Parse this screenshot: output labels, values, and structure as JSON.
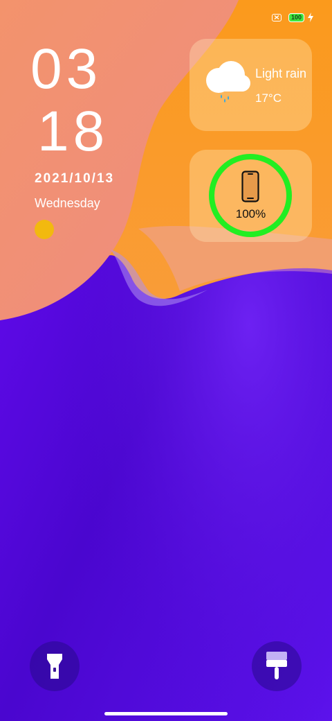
{
  "status_bar": {
    "battery_level": "100",
    "icons": [
      "x-badge-icon",
      "battery-icon",
      "charging-bolt-icon"
    ]
  },
  "lock_screen": {
    "hour": "03",
    "minute": "18",
    "date": "2021/10/13",
    "weekday": "Wednesday"
  },
  "weather_widget": {
    "condition": "Light rain",
    "temperature": "17°C",
    "icon": "cloud-rain-icon"
  },
  "battery_widget": {
    "percent_label": "100%",
    "level": 1.0,
    "ring_color": "#22ee22",
    "icon": "phone-icon"
  },
  "shortcuts": {
    "left": "flashlight-icon",
    "right": "theme-brush-icon"
  },
  "colors": {
    "wallpaper_peach": "#f2906e",
    "wallpaper_orange": "#fb9d22",
    "wallpaper_purple": "#5a0fe8",
    "accent_green": "#22ee22"
  }
}
